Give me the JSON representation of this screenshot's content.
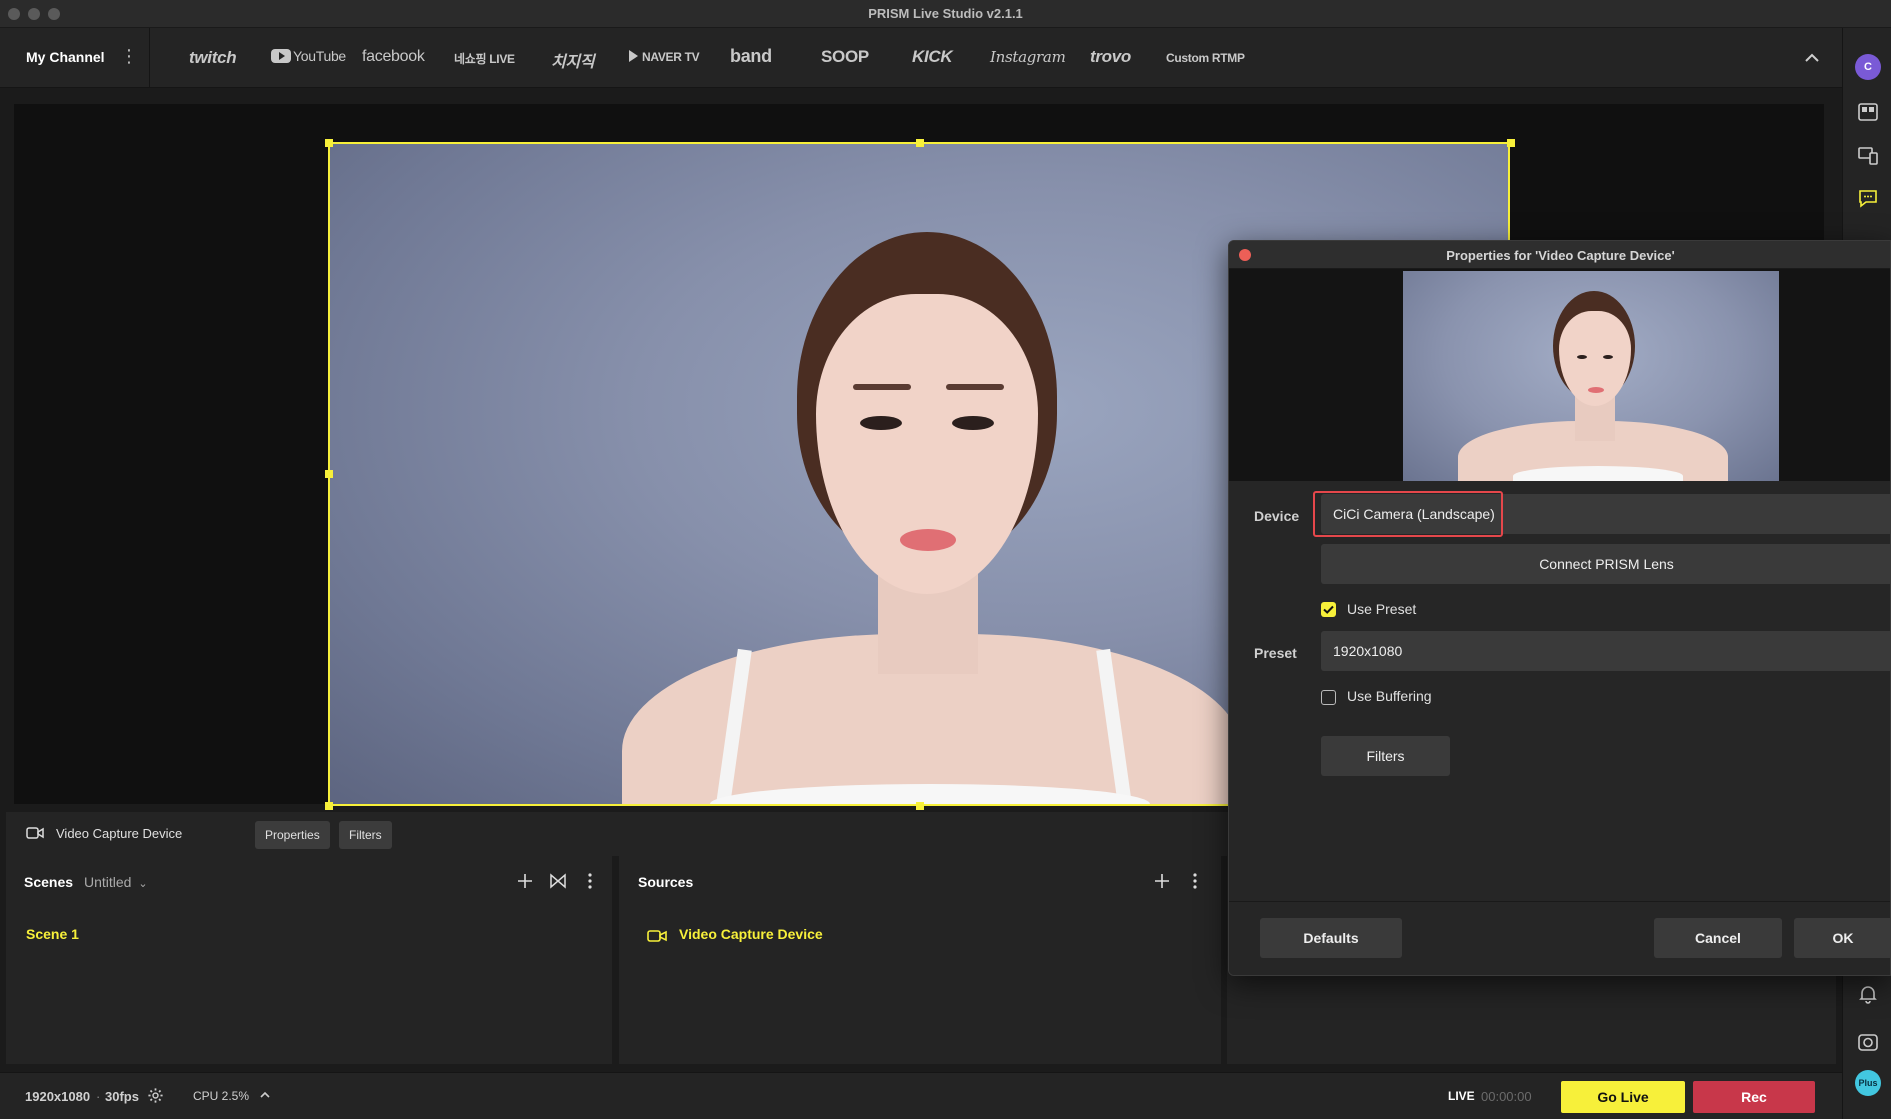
{
  "window": {
    "title": "PRISM Live Studio v2.1.1"
  },
  "channel_bar": {
    "my_channel": "My Channel",
    "platforms": [
      "twitch",
      "YouTube",
      "facebook",
      "네쇼핑 LIVE",
      "치지직",
      "NAVER TV",
      "band",
      "SOOP",
      "KICK",
      "Instagram",
      "trovo",
      "Custom RTMP"
    ]
  },
  "source_bar": {
    "name": "Video Capture Device",
    "properties_label": "Properties",
    "filters_label": "Filters"
  },
  "scenes": {
    "title": "Scenes",
    "collection": "Untitled",
    "items": [
      "Scene 1"
    ]
  },
  "sources": {
    "title": "Sources",
    "items": [
      "Video Capture Device"
    ]
  },
  "status": {
    "resolution": "1920x1080",
    "fps": "30fps",
    "cpu": "CPU 2.5%",
    "live_label": "LIVE",
    "timer": "00:00:00",
    "go_live": "Go Live",
    "rec": "Rec"
  },
  "dialog": {
    "title": "Properties for 'Video Capture Device'",
    "device_label": "Device",
    "device_value": "CiCi Camera (Landscape)",
    "connect_lens": "Connect PRISM Lens",
    "use_preset": "Use Preset",
    "use_preset_checked": true,
    "preset_label": "Preset",
    "preset_value": "1920x1080",
    "use_buffering": "Use Buffering",
    "use_buffering_checked": false,
    "filters": "Filters",
    "defaults": "Defaults",
    "cancel": "Cancel",
    "ok": "OK"
  },
  "right_sidebar": {
    "avatar_initial": "C",
    "plus_label": "Plus"
  },
  "colors": {
    "accent_yellow": "#f7f03a",
    "rec_red": "#c8374a",
    "highlight_red": "#e5474b",
    "plus_cyan": "#42c7e0"
  }
}
